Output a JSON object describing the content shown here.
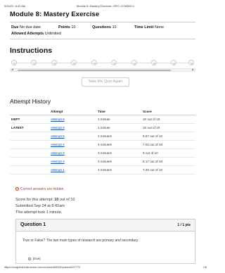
{
  "print_header": {
    "datetime": "9/24/22, 8:43 AM",
    "page_title": "Module 8: Mastery Exercise: 22FC-COM300-2"
  },
  "quiz": {
    "title": "Module 8: Mastery Exercise",
    "due_label": "Due",
    "due_value": "No due date",
    "points_label": "Points",
    "points_value": "10",
    "questions_label": "Questions",
    "questions_value": "10",
    "time_limit_label": "Time Limit",
    "time_limit_value": "None",
    "allowed_label": "Allowed Attempts",
    "allowed_value": "Unlimited"
  },
  "instructions": {
    "heading": "Instructions",
    "take_quiz_label": "Take the Quiz Again"
  },
  "attempt_history": {
    "heading": "Attempt History",
    "columns": [
      "",
      "Attempt",
      "Time",
      "Score"
    ],
    "rows": [
      {
        "label": "KEPT",
        "attempt": "Attempt 6",
        "time": "1 minute",
        "score": "10 out of 10"
      },
      {
        "label": "LATEST",
        "attempt": "Attempt 6",
        "time": "1 minute",
        "score": "10 out of 10"
      },
      {
        "label": "",
        "attempt": "Attempt 5",
        "time": "2 minutes",
        "score": "9.67 out of 10"
      },
      {
        "label": "",
        "attempt": "Attempt 4",
        "time": "4 minutes",
        "score": "7.83 out of 10"
      },
      {
        "label": "",
        "attempt": "Attempt 3",
        "time": "3 minutes",
        "score": "9 out of 10"
      },
      {
        "label": "",
        "attempt": "Attempt 2",
        "time": "3 minutes",
        "score": "8.17 out of 10"
      },
      {
        "label": "",
        "attempt": "Attempt 1",
        "time": "4 minutes",
        "score": "7.25 out of 10"
      }
    ]
  },
  "results": {
    "hidden_notice": "Correct answers are hidden.",
    "score_prefix": "Score for this attempt:",
    "score_value": "10",
    "score_suffix": "out of 10",
    "submitted": "Submitted Sep 24 at 8:42am",
    "duration": "This attempt took 1 minute."
  },
  "question": {
    "title": "Question 1",
    "points": "1 / 1 pts",
    "text": "True or False? The two main types of research are primary and secondary.",
    "option_1": "[true]"
  },
  "print_footer": {
    "url": "https://csuglobal.instructure.com/courses/69515/quizzes/627772",
    "page": "1/6"
  }
}
